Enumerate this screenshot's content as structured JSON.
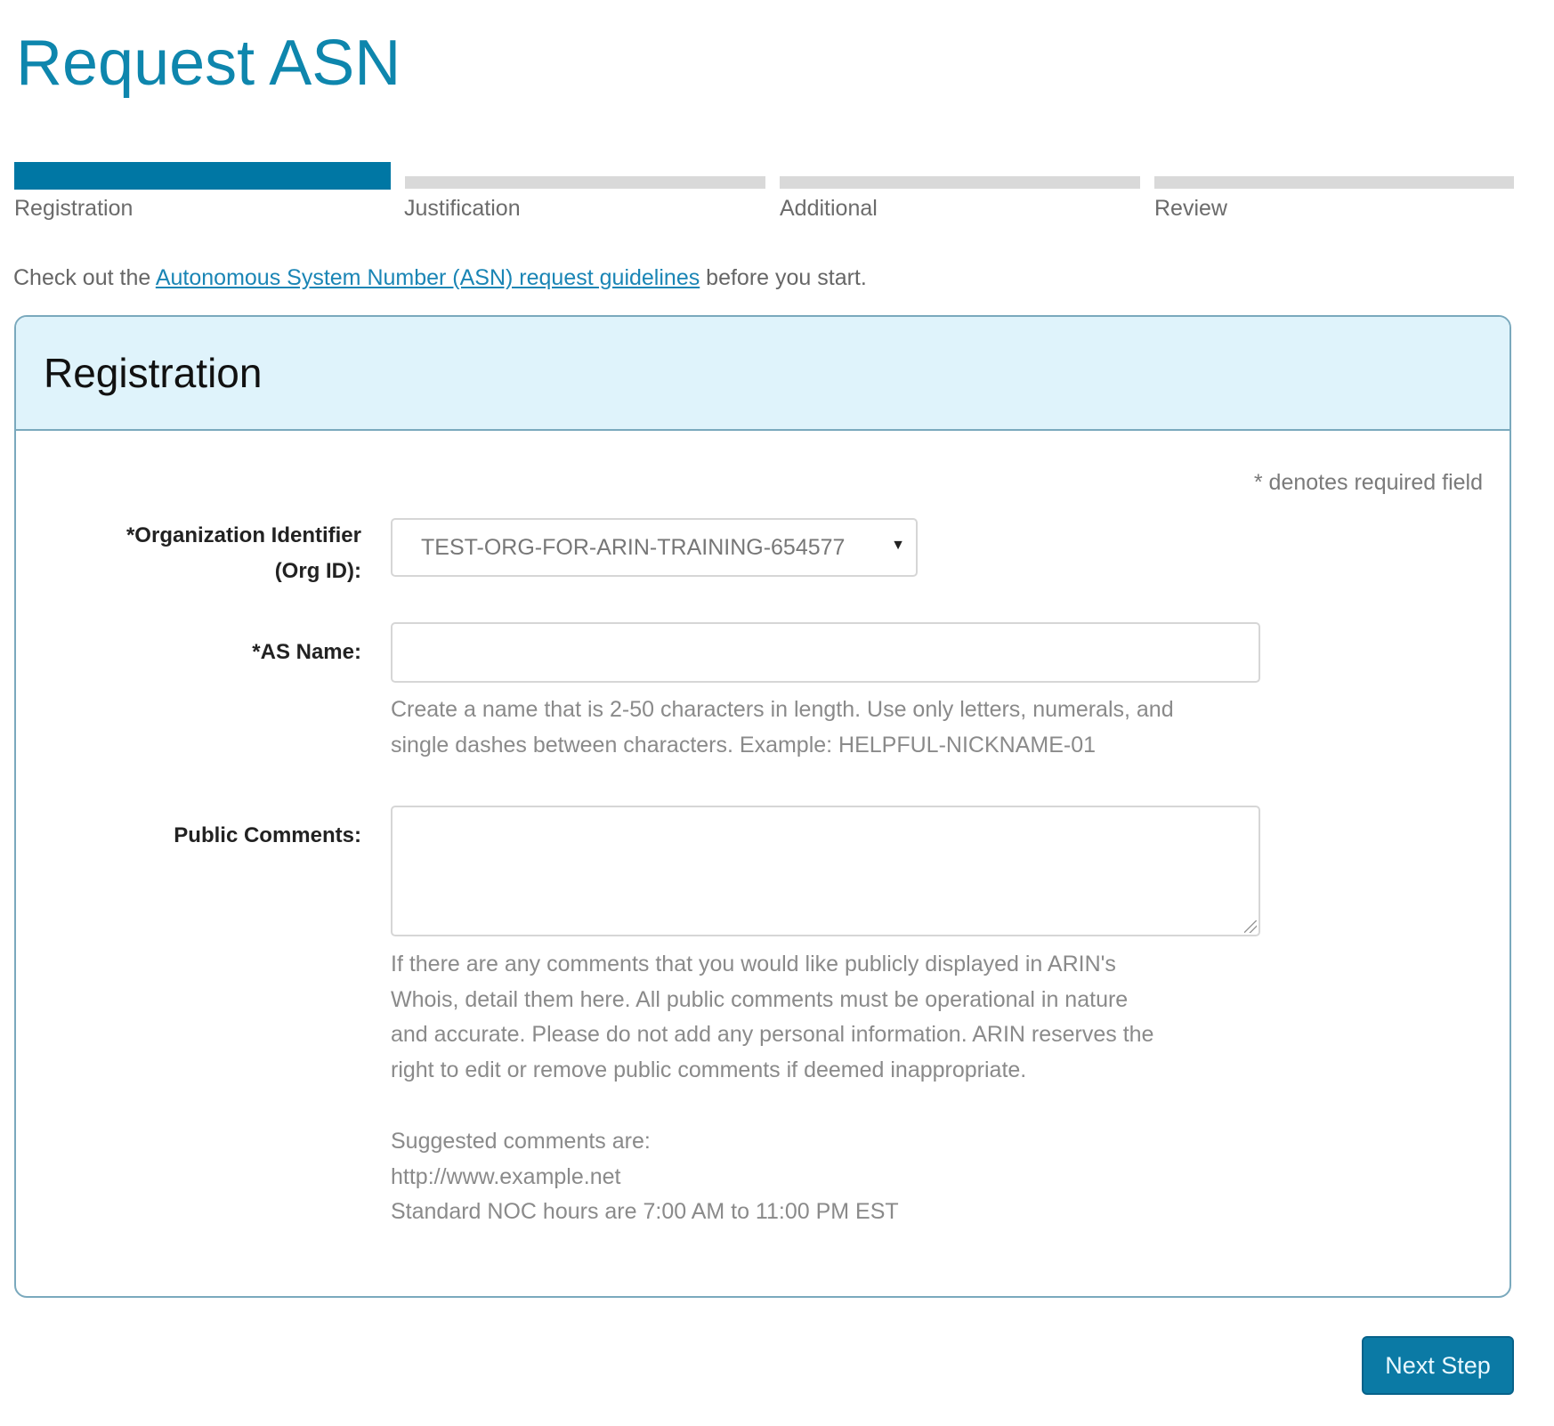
{
  "page": {
    "title": "Request ASN"
  },
  "progress": {
    "steps": [
      {
        "label": "Registration",
        "state": "active"
      },
      {
        "label": "Justification",
        "state": "inactive"
      },
      {
        "label": "Additional",
        "state": "inactive"
      },
      {
        "label": "Review",
        "state": "inactive"
      }
    ],
    "current_step": 1,
    "total_steps": 4
  },
  "intro": {
    "prefix": "Check out the ",
    "link_text": "Autonomous System Number (ASN) request guidelines",
    "suffix": " before you start."
  },
  "panel": {
    "title": "Registration",
    "required_note": "* denotes required field",
    "fields": {
      "org_id": {
        "label_line1": "*Organization Identifier",
        "label_line2": "(Org ID):",
        "selected_value": "TEST-ORG-FOR-ARIN-TRAINING-654577",
        "caret_icon": "▼"
      },
      "as_name": {
        "label": "*AS Name:",
        "value": "",
        "help_line1": "Create a name that is 2-50 characters in length. Use only letters, numerals, and",
        "help_line2": "single dashes between characters. Example: HELPFUL-NICKNAME-01"
      },
      "public_comments": {
        "label": "Public Comments:",
        "value": "",
        "help_lines": [
          "If there are any comments that you would like publicly displayed in ARIN's",
          "Whois, detail them here. All public comments must be operational in nature",
          "and accurate. Please do not add any personal information. ARIN reserves the",
          "right to edit or remove public comments if deemed inappropriate."
        ],
        "suggested_lines": [
          "Suggested comments are:",
          "http://www.example.net",
          "Standard NOC hours are 7:00 AM to 11:00 PM EST"
        ]
      }
    }
  },
  "actions": {
    "next_label": "Next Step"
  },
  "colors": {
    "accent": "#0077a4",
    "title": "#0e86ad",
    "panel_header_bg": "#dff3fb",
    "link": "#1a85b5"
  }
}
